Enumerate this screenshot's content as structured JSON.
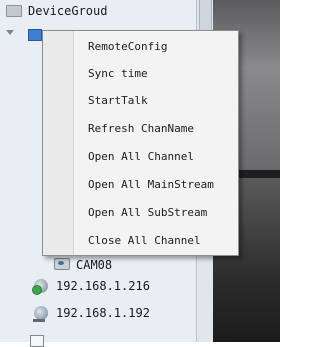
{
  "tree": {
    "root_label": "DeviceGroud",
    "camera_label": "CAM08",
    "devices": [
      {
        "ip": "192.168.1.216",
        "status": "online"
      },
      {
        "ip": "192.168.1.192",
        "status": "offline"
      }
    ]
  },
  "context_menu": {
    "items": [
      "RemoteConfig",
      "Sync time",
      "StartTalk",
      "Refresh ChanName",
      "Open All Channel",
      "Open All MainStream",
      "Open All SubStream",
      "Close All Channel"
    ]
  }
}
